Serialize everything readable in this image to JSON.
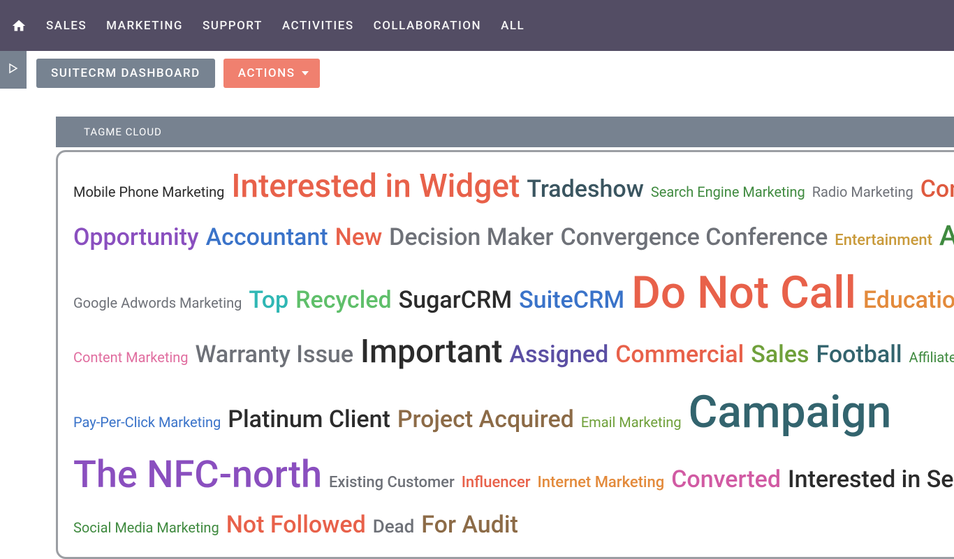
{
  "nav": {
    "items": [
      "SALES",
      "MARKETING",
      "SUPPORT",
      "ACTIVITIES",
      "COLLABORATION",
      "ALL"
    ]
  },
  "subbar": {
    "dashboard_label": "SUITECRM DASHBOARD",
    "actions_label": "ACTIONS"
  },
  "widget": {
    "title": "TAGME CLOUD"
  },
  "tags": {
    "row1": [
      {
        "label": "Mobile Phone Marketing",
        "size": "sz1",
        "color": "c-black"
      },
      {
        "label": "Interested in Widget",
        "size": "sz7",
        "color": "c-coral"
      },
      {
        "label": "Tradeshow",
        "size": "sz5",
        "color": "c-darkslate"
      },
      {
        "label": "Search Engine Marketing",
        "size": "sz1",
        "color": "c-green"
      },
      {
        "label": "Radio Marketing",
        "size": "sz1",
        "color": "c-gray"
      },
      {
        "label": "Consumer",
        "size": "sz5",
        "color": "c-red"
      }
    ],
    "row2": [
      {
        "label": "Opportunity",
        "size": "sz5",
        "color": "c-purple"
      },
      {
        "label": "Accountant",
        "size": "sz5",
        "color": "c-blue"
      },
      {
        "label": "New",
        "size": "sz5",
        "color": "c-coral"
      },
      {
        "label": "Decision Maker",
        "size": "sz5",
        "color": "c-gray"
      },
      {
        "label": "Convergence Conference",
        "size": "sz5",
        "color": "c-gray"
      },
      {
        "label": "Entertainment",
        "size": "sz2",
        "color": "c-gold"
      },
      {
        "label": "Agriculture",
        "size": "sz6",
        "color": "c-green"
      }
    ],
    "row3": [
      {
        "label": "Google Adwords Marketing",
        "size": "sz1",
        "color": "c-gray"
      },
      {
        "label": "Top",
        "size": "sz5",
        "color": "c-cyan"
      },
      {
        "label": "Recycled",
        "size": "sz5",
        "color": "c-lime"
      },
      {
        "label": "SugarCRM",
        "size": "sz5",
        "color": "c-black"
      },
      {
        "label": "SuiteCRM",
        "size": "sz5",
        "color": "c-blue"
      },
      {
        "label": "Do Not Call",
        "size": "sz9",
        "color": "c-coral"
      },
      {
        "label": "Educational In",
        "size": "sz5",
        "color": "c-orange"
      }
    ],
    "row4": [
      {
        "label": "Content Marketing",
        "size": "sz1",
        "color": "c-pink"
      },
      {
        "label": "Warranty Issue",
        "size": "sz5",
        "color": "c-gray"
      },
      {
        "label": "Important",
        "size": "sz7",
        "color": "c-black"
      },
      {
        "label": "Assigned",
        "size": "sz5",
        "color": "c-indigo"
      },
      {
        "label": "Commercial",
        "size": "sz5",
        "color": "c-coral"
      },
      {
        "label": "Sales",
        "size": "sz5",
        "color": "c-olive"
      },
      {
        "label": "Football",
        "size": "sz5",
        "color": "c-tealdk"
      },
      {
        "label": "Affiliate Marketing",
        "size": "sz1",
        "color": "c-green"
      }
    ],
    "row5": [
      {
        "label": "Pay-Per-Click Marketing",
        "size": "sz1",
        "color": "c-blue"
      },
      {
        "label": "Platinum Client",
        "size": "sz5",
        "color": "c-black"
      },
      {
        "label": "Project Acquired",
        "size": "sz5",
        "color": "c-brown"
      },
      {
        "label": "Email Marketing",
        "size": "sz1",
        "color": "c-olive"
      },
      {
        "label": "Campaign",
        "size": "sz9",
        "color": "c-tealdk"
      }
    ],
    "row6": [
      {
        "label": "The NFC-north",
        "size": "sz8",
        "color": "c-purple"
      },
      {
        "label": "Existing Customer",
        "size": "sz2",
        "color": "c-gray"
      },
      {
        "label": "Influencer",
        "size": "sz2",
        "color": "c-coral"
      },
      {
        "label": "Internet Marketing",
        "size": "sz2",
        "color": "c-orange"
      },
      {
        "label": "Converted",
        "size": "sz5",
        "color": "c-magenta"
      },
      {
        "label": "Interested in Service",
        "size": "sz5",
        "color": "c-black"
      }
    ],
    "row7": [
      {
        "label": "Social Media Marketing",
        "size": "sz1",
        "color": "c-green"
      },
      {
        "label": "Not Followed",
        "size": "sz5",
        "color": "c-coral"
      },
      {
        "label": "Dead",
        "size": "sz3",
        "color": "c-gray"
      },
      {
        "label": "For Audit",
        "size": "sz5",
        "color": "c-brown"
      }
    ]
  }
}
